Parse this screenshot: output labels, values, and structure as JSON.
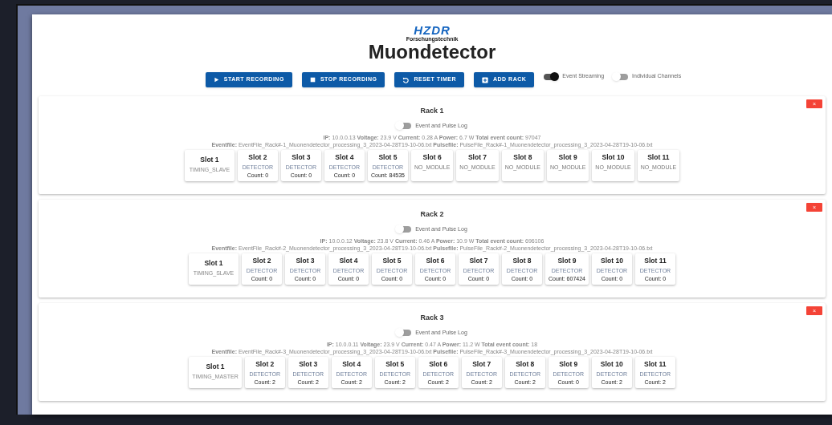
{
  "logo": {
    "name": "HZDR",
    "subtitle": "Forschungstechnik"
  },
  "title": "Muondetector",
  "toolbar": {
    "buttons": [
      {
        "label": "START RECORDING"
      },
      {
        "label": "STOP RECORDING"
      },
      {
        "label": "RESET TIMER"
      },
      {
        "label": "ADD RACK"
      }
    ],
    "switches": [
      {
        "label": "Event Streaming",
        "on": true
      },
      {
        "label": "Individual Channels",
        "on": false
      }
    ]
  },
  "racks": [
    {
      "title": "Rack 1",
      "log_switch": {
        "label": "Event and Pulse Log",
        "on": false
      },
      "info": "**IP:** 10.0.0.13 **Voltage:** 23.9 V **Current:** 0.28 A **Power:** 6.7 W **Total event count:** 97047",
      "files": "**Eventfile:** EventFile_Rack#-1_Muonendetector_processing_3_2023-04-28T19-10-06.txt **Pulsefile:** PulseFile_Rack#-1_Muonendetector_processing_3_2023-04-28T19-10-06.txt",
      "delete_label": "×",
      "slots": [
        {
          "name": "Slot 1",
          "type": "TIMING_SLAVE"
        },
        {
          "name": "Slot 2",
          "type": "DETECTOR",
          "count": "Count: 0"
        },
        {
          "name": "Slot 3",
          "type": "DETECTOR",
          "count": "Count: 0"
        },
        {
          "name": "Slot 4",
          "type": "DETECTOR",
          "count": "Count: 0"
        },
        {
          "name": "Slot 5",
          "type": "DETECTOR",
          "count": "Count: 84535"
        },
        {
          "name": "Slot 6",
          "type": "NO_MODULE"
        },
        {
          "name": "Slot 7",
          "type": "NO_MODULE"
        },
        {
          "name": "Slot 8",
          "type": "NO_MODULE"
        },
        {
          "name": "Slot 9",
          "type": "NO_MODULE"
        },
        {
          "name": "Slot 10",
          "type": "NO_MODULE"
        },
        {
          "name": "Slot 11",
          "type": "NO_MODULE"
        }
      ]
    },
    {
      "title": "Rack 2",
      "log_switch": {
        "label": "Event and Pulse Log",
        "on": false
      },
      "info": "**IP:** 10.0.0.12 **Voltage:** 23.8 V **Current:** 0.46 A **Power:** 10.9 W **Total event count:** 696106",
      "files": "**Eventfile:** EventFile_Rack#-2_Muonendetector_processing_3_2023-04-28T19-10-06.txt **Pulsefile:** PulseFile_Rack#-2_Muonendetector_processing_3_2023-04-28T19-10-06.txt",
      "delete_label": "×",
      "slots": [
        {
          "name": "Slot 1",
          "type": "TIMING_SLAVE"
        },
        {
          "name": "Slot 2",
          "type": "DETECTOR",
          "count": "Count: 0"
        },
        {
          "name": "Slot 3",
          "type": "DETECTOR",
          "count": "Count: 0"
        },
        {
          "name": "Slot 4",
          "type": "DETECTOR",
          "count": "Count: 0"
        },
        {
          "name": "Slot 5",
          "type": "DETECTOR",
          "count": "Count: 0"
        },
        {
          "name": "Slot 6",
          "type": "DETECTOR",
          "count": "Count: 0"
        },
        {
          "name": "Slot 7",
          "type": "DETECTOR",
          "count": "Count: 0"
        },
        {
          "name": "Slot 8",
          "type": "DETECTOR",
          "count": "Count: 0"
        },
        {
          "name": "Slot 9",
          "type": "DETECTOR",
          "count": "Count: 607424"
        },
        {
          "name": "Slot 10",
          "type": "DETECTOR",
          "count": "Count: 0"
        },
        {
          "name": "Slot 11",
          "type": "DETECTOR",
          "count": "Count: 0"
        }
      ]
    },
    {
      "title": "Rack 3",
      "log_switch": {
        "label": "Event and Pulse Log",
        "on": false
      },
      "info": "**IP:** 10.0.0.11 **Voltage:** 23.9 V **Current:** 0.47 A **Power:** 11.2 W **Total event count:** 18",
      "files": "**Eventfile:** EventFile_Rack#-3_Muonendetector_processing_3_2023-04-28T19-10-06.txt **Pulsefile:** PulseFile_Rack#-3_Muonendetector_processing_3_2023-04-28T19-10-06.txt",
      "delete_label": "×",
      "slots": [
        {
          "name": "Slot 1",
          "type": "TIMING_MASTER"
        },
        {
          "name": "Slot 2",
          "type": "DETECTOR",
          "count": "Count: 2"
        },
        {
          "name": "Slot 3",
          "type": "DETECTOR",
          "count": "Count: 2"
        },
        {
          "name": "Slot 4",
          "type": "DETECTOR",
          "count": "Count: 2"
        },
        {
          "name": "Slot 5",
          "type": "DETECTOR",
          "count": "Count: 2"
        },
        {
          "name": "Slot 6",
          "type": "DETECTOR",
          "count": "Count: 2"
        },
        {
          "name": "Slot 7",
          "type": "DETECTOR",
          "count": "Count: 2"
        },
        {
          "name": "Slot 8",
          "type": "DETECTOR",
          "count": "Count: 2"
        },
        {
          "name": "Slot 9",
          "type": "DETECTOR",
          "count": "Count: 0"
        },
        {
          "name": "Slot 10",
          "type": "DETECTOR",
          "count": "Count: 2"
        },
        {
          "name": "Slot 11",
          "type": "DETECTOR",
          "count": "Count: 2"
        }
      ]
    }
  ]
}
